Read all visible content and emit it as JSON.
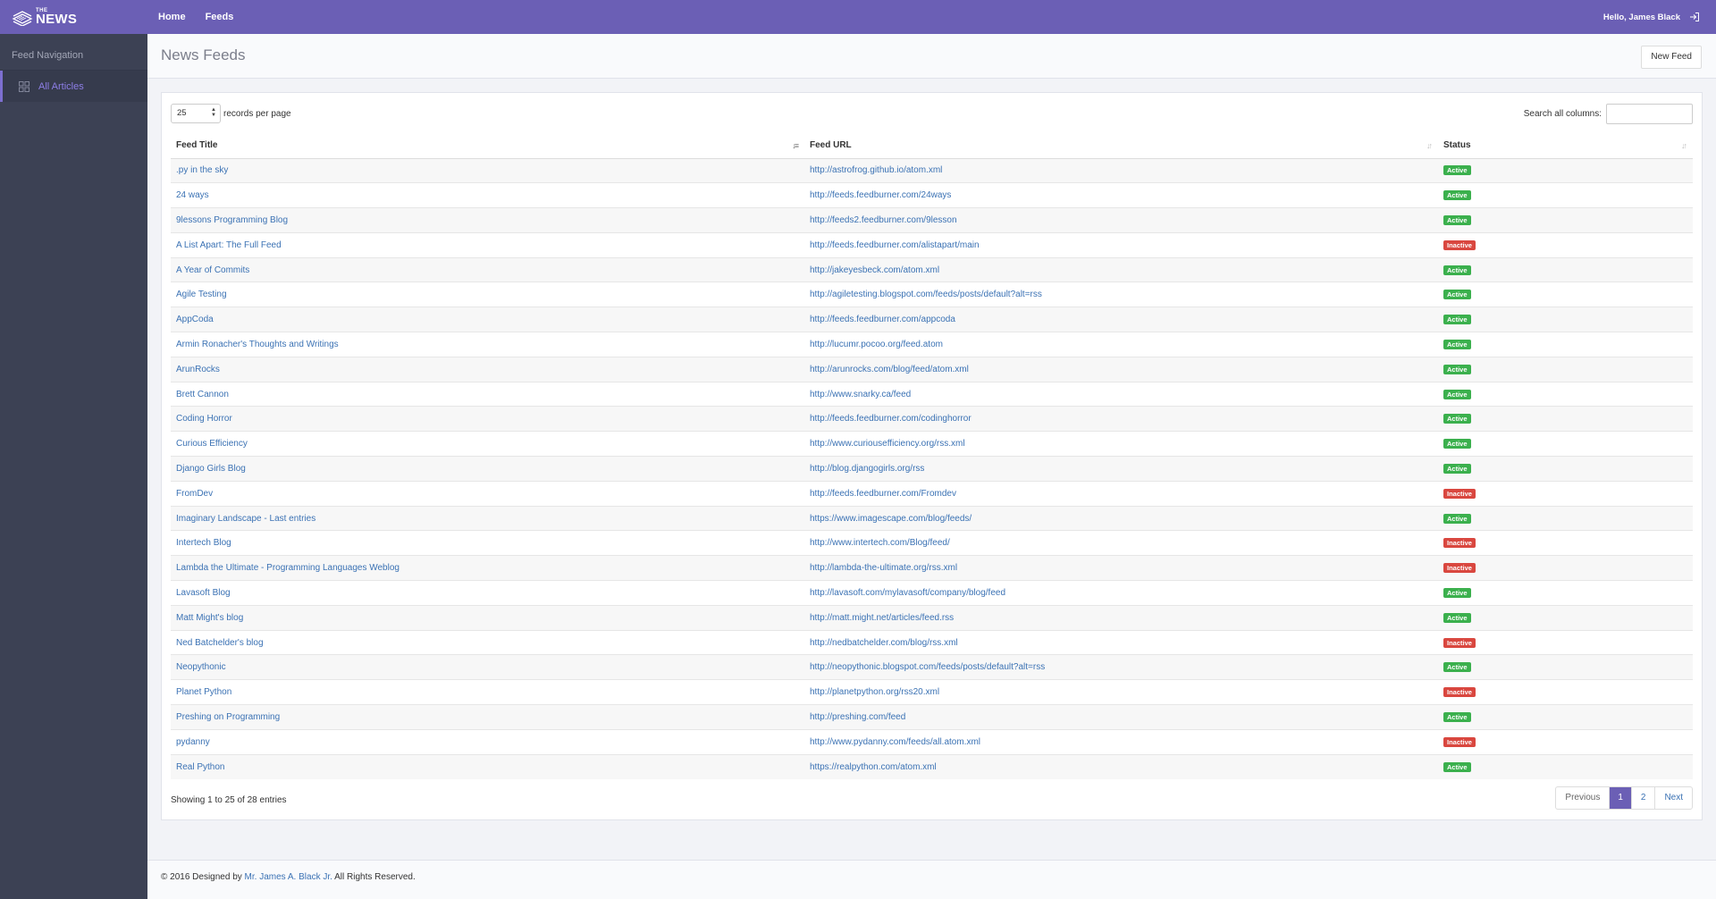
{
  "brand": {
    "small": "THE",
    "big": "NEWS"
  },
  "topnav": [
    {
      "label": "Home"
    },
    {
      "label": "Feeds"
    }
  ],
  "user": {
    "greeting": "Hello, James Black"
  },
  "sidebar": {
    "header": "Feed Navigation",
    "items": [
      {
        "label": "All Articles",
        "icon": "grid-icon",
        "active": true
      }
    ]
  },
  "page": {
    "title": "News Feeds",
    "new_feed_label": "New Feed"
  },
  "table_controls": {
    "per_page_value": "25",
    "per_page_label": "records per page",
    "search_label": "Search all columns:",
    "search_value": ""
  },
  "table": {
    "columns": [
      "Feed Title",
      "Feed URL",
      "Status"
    ],
    "rows": [
      {
        "title": ".py in the sky",
        "url": "http://astrofrog.github.io/atom.xml",
        "status": "Active"
      },
      {
        "title": "24 ways",
        "url": "http://feeds.feedburner.com/24ways",
        "status": "Active"
      },
      {
        "title": "9lessons Programming Blog",
        "url": "http://feeds2.feedburner.com/9lesson",
        "status": "Active"
      },
      {
        "title": "A List Apart: The Full Feed",
        "url": "http://feeds.feedburner.com/alistapart/main",
        "status": "Inactive"
      },
      {
        "title": "A Year of Commits",
        "url": "http://jakeyesbeck.com/atom.xml",
        "status": "Active"
      },
      {
        "title": "Agile Testing",
        "url": "http://agiletesting.blogspot.com/feeds/posts/default?alt=rss",
        "status": "Active"
      },
      {
        "title": "AppCoda",
        "url": "http://feeds.feedburner.com/appcoda",
        "status": "Active"
      },
      {
        "title": "Armin Ronacher's Thoughts and Writings",
        "url": "http://lucumr.pocoo.org/feed.atom",
        "status": "Active"
      },
      {
        "title": "ArunRocks",
        "url": "http://arunrocks.com/blog/feed/atom.xml",
        "status": "Active"
      },
      {
        "title": "Brett Cannon",
        "url": "http://www.snarky.ca/feed",
        "status": "Active"
      },
      {
        "title": "Coding Horror",
        "url": "http://feeds.feedburner.com/codinghorror",
        "status": "Active"
      },
      {
        "title": "Curious Efficiency",
        "url": "http://www.curiousefficiency.org/rss.xml",
        "status": "Active"
      },
      {
        "title": "Django Girls Blog",
        "url": "http://blog.djangogirls.org/rss",
        "status": "Active"
      },
      {
        "title": "FromDev",
        "url": "http://feeds.feedburner.com/Fromdev",
        "status": "Inactive"
      },
      {
        "title": "Imaginary Landscape - Last entries",
        "url": "https://www.imagescape.com/blog/feeds/",
        "status": "Active"
      },
      {
        "title": "Intertech Blog",
        "url": "http://www.intertech.com/Blog/feed/",
        "status": "Inactive"
      },
      {
        "title": "Lambda the Ultimate - Programming Languages Weblog",
        "url": "http://lambda-the-ultimate.org/rss.xml",
        "status": "Inactive"
      },
      {
        "title": "Lavasoft Blog",
        "url": "http://lavasoft.com/mylavasoft/company/blog/feed",
        "status": "Active"
      },
      {
        "title": "Matt Might's blog",
        "url": "http://matt.might.net/articles/feed.rss",
        "status": "Active"
      },
      {
        "title": "Ned Batchelder's blog",
        "url": "http://nedbatchelder.com/blog/rss.xml",
        "status": "Inactive"
      },
      {
        "title": "Neopythonic",
        "url": "http://neopythonic.blogspot.com/feeds/posts/default?alt=rss",
        "status": "Active"
      },
      {
        "title": "Planet Python",
        "url": "http://planetpython.org/rss20.xml",
        "status": "Inactive"
      },
      {
        "title": "Preshing on Programming",
        "url": "http://preshing.com/feed",
        "status": "Active"
      },
      {
        "title": "pydanny",
        "url": "http://www.pydanny.com/feeds/all.atom.xml",
        "status": "Inactive"
      },
      {
        "title": "Real Python",
        "url": "https://realpython.com/atom.xml",
        "status": "Active"
      }
    ],
    "info": "Showing 1 to 25 of 28 entries"
  },
  "pagination": {
    "previous": "Previous",
    "pages": [
      "1",
      "2"
    ],
    "current": "1",
    "next": "Next"
  },
  "footer": {
    "prefix": "© 2016 Designed by",
    "author": "Mr. James A. Black Jr.",
    "suffix": "All Rights Reserved."
  },
  "colors": {
    "topbar": "#6b5fb5",
    "sidebar": "#3c4154",
    "link": "#3b72b4",
    "active_badge": "#3bb04d",
    "inactive_badge": "#d9473f"
  }
}
